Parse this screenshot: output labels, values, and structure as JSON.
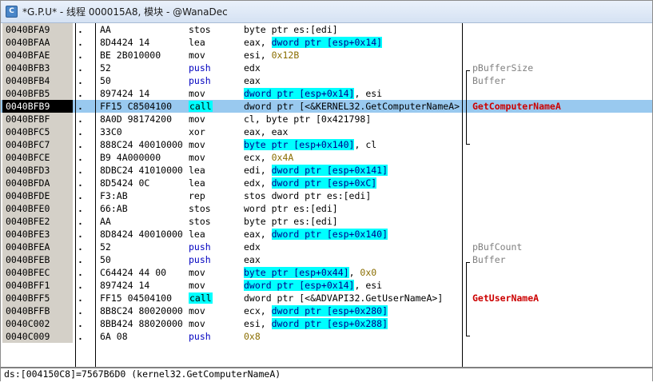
{
  "window": {
    "title": "*G.P.U* - 线程 000015A8, 模块 - @WanaDec",
    "icon": "cpu-window-icon"
  },
  "disasm": {
    "rows": [
      {
        "addr": "0040BFA9",
        "mark": ".",
        "hex": "AA",
        "mnem": "stos",
        "ops": [
          {
            "t": "byte ptr es:[edi]",
            "s": "n"
          }
        ],
        "cmt": ""
      },
      {
        "addr": "0040BFAA",
        "mark": ".",
        "hex": "8D4424 14",
        "mnem": "lea",
        "ops": [
          {
            "t": "eax, ",
            "s": "n"
          },
          {
            "t": "dword ptr [esp+0x14]",
            "s": "h"
          }
        ],
        "cmt": ""
      },
      {
        "addr": "0040BFAE",
        "mark": ".",
        "hex": "BE 2B010000",
        "mnem": "mov",
        "ops": [
          {
            "t": "esi, ",
            "s": "n"
          },
          {
            "t": "0x12B",
            "s": "i"
          }
        ],
        "cmt": ""
      },
      {
        "addr": "0040BFB3",
        "mark": ".",
        "hex": "52",
        "mnem": "push",
        "ops": [
          {
            "t": "edx",
            "s": "n"
          }
        ],
        "cmt": "pBufferSize",
        "ctype": "arg"
      },
      {
        "addr": "0040BFB4",
        "mark": ".",
        "hex": "50",
        "mnem": "push",
        "ops": [
          {
            "t": "eax",
            "s": "n"
          }
        ],
        "cmt": "Buffer",
        "ctype": "arg"
      },
      {
        "addr": "0040BFB5",
        "mark": ".",
        "hex": "897424 14",
        "mnem": "mov",
        "ops": [
          {
            "t": "dword ptr [esp+0x14]",
            "s": "h"
          },
          {
            "t": ", esi",
            "s": "n"
          }
        ],
        "cmt": ""
      },
      {
        "addr": "0040BFB9",
        "mark": ".",
        "hex": "FF15 C8504100",
        "mnem": "call",
        "ops": [
          {
            "t": "dword ptr [<&KERNEL32.GetComputerNameA>]",
            "s": "n"
          }
        ],
        "cmt": "GetComputerNameA",
        "ctype": "api",
        "selected": true
      },
      {
        "addr": "0040BFBF",
        "mark": ".",
        "hex": "8A0D 98174200",
        "mnem": "mov",
        "ops": [
          {
            "t": "cl, byte ptr [0x421798]",
            "s": "n"
          }
        ],
        "cmt": ""
      },
      {
        "addr": "0040BFC5",
        "mark": ".",
        "hex": "33C0",
        "mnem": "xor",
        "ops": [
          {
            "t": "eax, eax",
            "s": "n"
          }
        ],
        "cmt": ""
      },
      {
        "addr": "0040BFC7",
        "mark": ".",
        "hex": "888C24 40010000",
        "mnem": "mov",
        "ops": [
          {
            "t": "byte ptr [esp+0x140]",
            "s": "h"
          },
          {
            "t": ", cl",
            "s": "n"
          }
        ],
        "cmt": ""
      },
      {
        "addr": "0040BFCE",
        "mark": ".",
        "hex": "B9 4A000000",
        "mnem": "mov",
        "ops": [
          {
            "t": "ecx, ",
            "s": "n"
          },
          {
            "t": "0x4A",
            "s": "i"
          }
        ],
        "cmt": ""
      },
      {
        "addr": "0040BFD3",
        "mark": ".",
        "hex": "8DBC24 41010000",
        "mnem": "lea",
        "ops": [
          {
            "t": "edi, ",
            "s": "n"
          },
          {
            "t": "dword ptr [esp+0x141]",
            "s": "h"
          }
        ],
        "cmt": ""
      },
      {
        "addr": "0040BFDA",
        "mark": ".",
        "hex": "8D5424 0C",
        "mnem": "lea",
        "ops": [
          {
            "t": "edx, ",
            "s": "n"
          },
          {
            "t": "dword ptr [esp+0xC]",
            "s": "h"
          }
        ],
        "cmt": ""
      },
      {
        "addr": "0040BFDE",
        "mark": ".",
        "hex": "F3:AB",
        "mnem": "rep",
        "ops": [
          {
            "t": "stos dword ptr es:[edi]",
            "s": "n"
          }
        ],
        "cmt": ""
      },
      {
        "addr": "0040BFE0",
        "mark": ".",
        "hex": "66:AB",
        "mnem": "stos",
        "ops": [
          {
            "t": "word ptr es:[edi]",
            "s": "n"
          }
        ],
        "cmt": ""
      },
      {
        "addr": "0040BFE2",
        "mark": ".",
        "hex": "AA",
        "mnem": "stos",
        "ops": [
          {
            "t": "byte ptr es:[edi]",
            "s": "n"
          }
        ],
        "cmt": ""
      },
      {
        "addr": "0040BFE3",
        "mark": ".",
        "hex": "8D8424 40010000",
        "mnem": "lea",
        "ops": [
          {
            "t": "eax, ",
            "s": "n"
          },
          {
            "t": "dword ptr [esp+0x140]",
            "s": "h"
          }
        ],
        "cmt": ""
      },
      {
        "addr": "0040BFEA",
        "mark": ".",
        "hex": "52",
        "mnem": "push",
        "ops": [
          {
            "t": "edx",
            "s": "n"
          }
        ],
        "cmt": "pBufCount",
        "ctype": "arg"
      },
      {
        "addr": "0040BFEB",
        "mark": ".",
        "hex": "50",
        "mnem": "push",
        "ops": [
          {
            "t": "eax",
            "s": "n"
          }
        ],
        "cmt": "Buffer",
        "ctype": "arg"
      },
      {
        "addr": "0040BFEC",
        "mark": ".",
        "hex": "C64424 44 00",
        "mnem": "mov",
        "ops": [
          {
            "t": "byte ptr [esp+0x44]",
            "s": "h"
          },
          {
            "t": ", ",
            "s": "n"
          },
          {
            "t": "0x0",
            "s": "i"
          }
        ],
        "cmt": ""
      },
      {
        "addr": "0040BFF1",
        "mark": ".",
        "hex": "897424 14",
        "mnem": "mov",
        "ops": [
          {
            "t": "dword ptr [esp+0x14]",
            "s": "h"
          },
          {
            "t": ", esi",
            "s": "n"
          }
        ],
        "cmt": ""
      },
      {
        "addr": "0040BFF5",
        "mark": ".",
        "hex": "FF15 04504100",
        "mnem": "call",
        "ops": [
          {
            "t": "dword ptr [<&ADVAPI32.GetUserNameA>]",
            "s": "n"
          }
        ],
        "cmt": "GetUserNameA",
        "ctype": "api"
      },
      {
        "addr": "0040BFFB",
        "mark": ".",
        "hex": "8B8C24 80020000",
        "mnem": "mov",
        "ops": [
          {
            "t": "ecx, ",
            "s": "n"
          },
          {
            "t": "dword ptr [esp+0x280]",
            "s": "h"
          }
        ],
        "cmt": ""
      },
      {
        "addr": "0040C002",
        "mark": ".",
        "hex": "8BB424 88020000",
        "mnem": "mov",
        "ops": [
          {
            "t": "esi, ",
            "s": "n"
          },
          {
            "t": "dword ptr [esp+0x288]",
            "s": "h"
          }
        ],
        "cmt": ""
      },
      {
        "addr": "0040C009",
        "mark": ".",
        "hex": "6A 08",
        "mnem": "push",
        "ops": [
          {
            "t": "0x8",
            "s": "i"
          }
        ],
        "cmt": ""
      }
    ]
  },
  "status": {
    "text": "ds:[004150C8]=7567B6D0 (kernel32.GetComputerNameA)"
  }
}
